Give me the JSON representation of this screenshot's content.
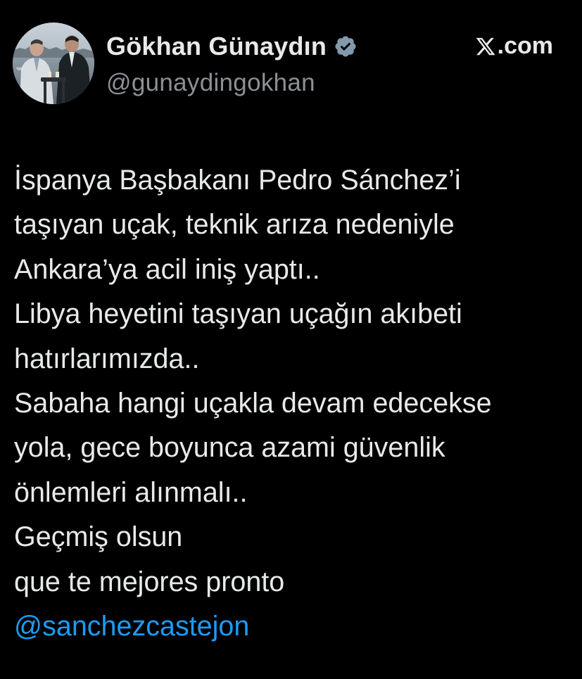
{
  "author": {
    "display_name": "Gökhan Günaydın",
    "handle": "@gunaydingokhan",
    "verified_icon": "verified-badge-icon",
    "avatar": "profile-photo"
  },
  "brand": {
    "label": ".com",
    "logo_icon": "x-logo-icon"
  },
  "tweet": {
    "lines": [
      "İspanya Başbakanı Pedro Sánchez’i",
      "taşıyan uçak, teknik arıza nedeniyle",
      "Ankara’ya acil iniş yaptı..",
      "Libya heyetini taşıyan uçağın akıbeti",
      "hatırlarımızda..",
      "Sabaha hangi uçakla devam edecekse",
      "yola, gece boyunca azami güvenlik",
      "önlemleri alınmalı..",
      "Geçmiş olsun",
      "que te mejores pronto"
    ],
    "mention": "@sanchezcastejon"
  },
  "colors": {
    "background": "#000000",
    "text": "#e7e9ea",
    "secondary_text": "#8b9095",
    "mention": "#1d9bf0"
  }
}
